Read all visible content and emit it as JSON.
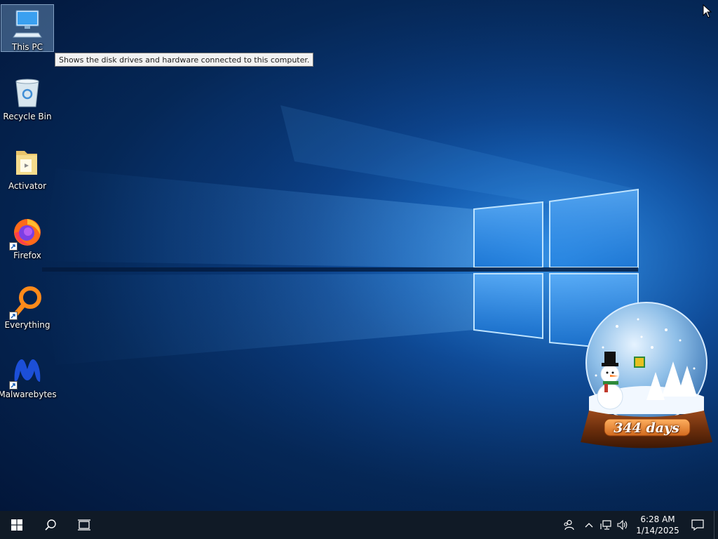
{
  "desktop": {
    "icons": [
      {
        "label": "This PC",
        "icon": "this-pc-icon",
        "selected": true
      },
      {
        "label": "Recycle Bin",
        "icon": "recycle-bin-icon"
      },
      {
        "label": "Activator",
        "icon": "folder-icon"
      },
      {
        "label": "Firefox",
        "icon": "firefox-icon",
        "shortcut": true
      },
      {
        "label": "Everything",
        "icon": "everything-search-icon",
        "shortcut": true
      },
      {
        "label": "Malwarebytes",
        "icon": "malwarebytes-icon",
        "shortcut": true
      }
    ],
    "tooltip": "Shows the disk drives and hardware connected to this computer."
  },
  "widget": {
    "days_label": "344 days",
    "icon": "snow-globe-icon"
  },
  "taskbar": {
    "start_icon": "windows-logo-icon",
    "search_icon": "search-icon",
    "task_view_icon": "task-view-icon",
    "tray": {
      "people_icon": "people-icon",
      "chevron_icon": "chevron-up-icon",
      "network_icon": "network-icon",
      "volume_icon": "volume-icon",
      "time": "6:28 AM",
      "date": "1/14/2025",
      "notification_icon": "action-center-icon"
    }
  },
  "colors": {
    "taskbar": "#101a26",
    "wallpaper_light": "#3fa3ff",
    "wallpaper_dark": "#021436"
  }
}
